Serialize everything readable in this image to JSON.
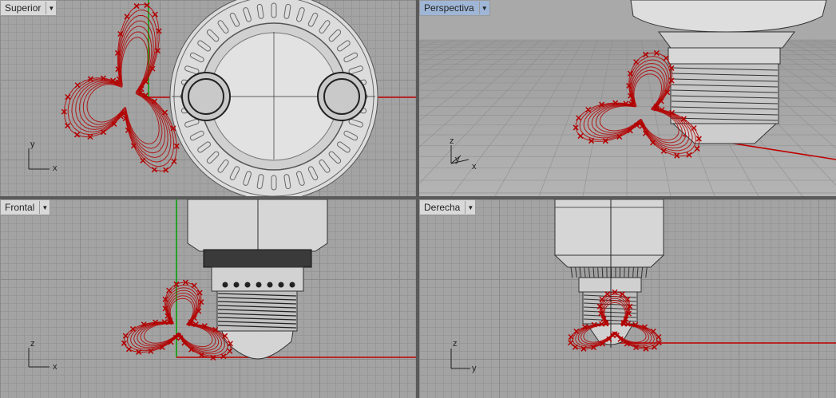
{
  "viewports": {
    "top": {
      "title": "Superior",
      "axis_h": "x",
      "axis_v": "y"
    },
    "perspective": {
      "title": "Perspectiva",
      "axis_h": "y",
      "axis_v": "z",
      "axis_x": "x"
    },
    "front": {
      "title": "Frontal",
      "axis_h": "x",
      "axis_v": "z"
    },
    "right": {
      "title": "Derecha",
      "axis_h": "y",
      "axis_v": "z"
    }
  },
  "icons": {
    "dropdown": "dropdown-arrow-icon"
  },
  "colors": {
    "grid_bg": "#a3a3a3",
    "active_tab": "#9fb6d6",
    "curves": "#b30000",
    "x_axis": "#c00000",
    "y_axis": "#00a000"
  }
}
